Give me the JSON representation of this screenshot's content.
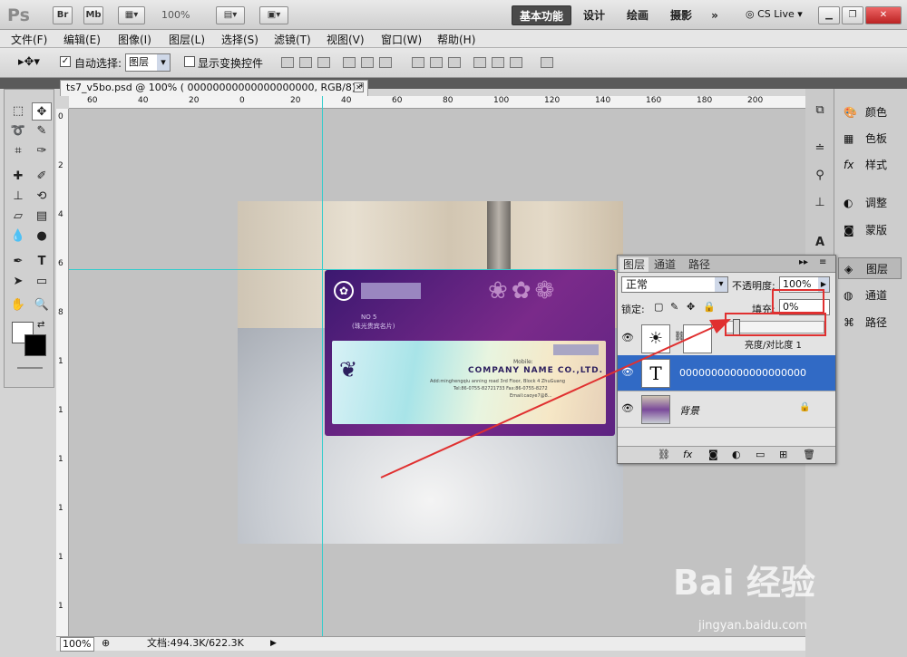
{
  "app": {
    "logo": "Ps",
    "btn_br": "Br",
    "btn_mb": "Mb",
    "zoom": "100%"
  },
  "workspaces": [
    "基本功能",
    "设计",
    "绘画",
    "摄影",
    "»"
  ],
  "cslive": "CS Live",
  "menu": [
    "文件(F)",
    "编辑(E)",
    "图像(I)",
    "图层(L)",
    "选择(S)",
    "滤镜(T)",
    "视图(V)",
    "窗口(W)",
    "帮助(H)"
  ],
  "options": {
    "auto_select_label": "自动选择:",
    "auto_select_value": "图层",
    "show_transform": "显示变换控件"
  },
  "document": {
    "tab_title": "ts7_v5bo.psd @ 100% ( 00000000000000000000, RGB/8) *"
  },
  "ruler_h": [
    "60",
    "40",
    "20",
    "0",
    "20",
    "40",
    "60",
    "80",
    "100",
    "120",
    "140",
    "160",
    "180",
    "200"
  ],
  "ruler_v": [
    "0",
    "2",
    "4",
    "6",
    "8",
    "1",
    "1",
    "1",
    "1",
    "1",
    "1",
    "2"
  ],
  "status": {
    "zoom": "100%",
    "doc": "文档:494.3K/622.3K"
  },
  "card": {
    "company": "COMPANY NAME CO.,LTD.",
    "no": "NO 5",
    "sub": "(珠光贵宾名片)",
    "mobile": "Mobile:",
    "addr": "Add:minghengqiu anning road 3rd Floor, Block 4 ZhuGuang",
    "tel": "Tel:86-0755-82721733  Fax:86-0755-8272",
    "email": "Email:caoye7@8..."
  },
  "layers_panel": {
    "tabs": [
      "图层",
      "通道",
      "路径"
    ],
    "blend_mode": "正常",
    "opacity_label": "不透明度:",
    "opacity_value": "100%",
    "lock_label": "锁定:",
    "fill_label": "填充:",
    "fill_value": "0%",
    "layers": [
      {
        "name": "亮度/对比度 1"
      },
      {
        "name": "00000000000000000000"
      },
      {
        "name": "背景"
      }
    ]
  },
  "dock": [
    "颜色",
    "色板",
    "样式",
    "调整",
    "蒙版",
    "图层",
    "通道",
    "路径"
  ],
  "watermark": {
    "brand": "Bai 经验",
    "url": "jingyan.baidu.com"
  },
  "colors": {
    "highlight": "#316ac5",
    "annotation": "#e03030",
    "guide": "#33cccc"
  }
}
